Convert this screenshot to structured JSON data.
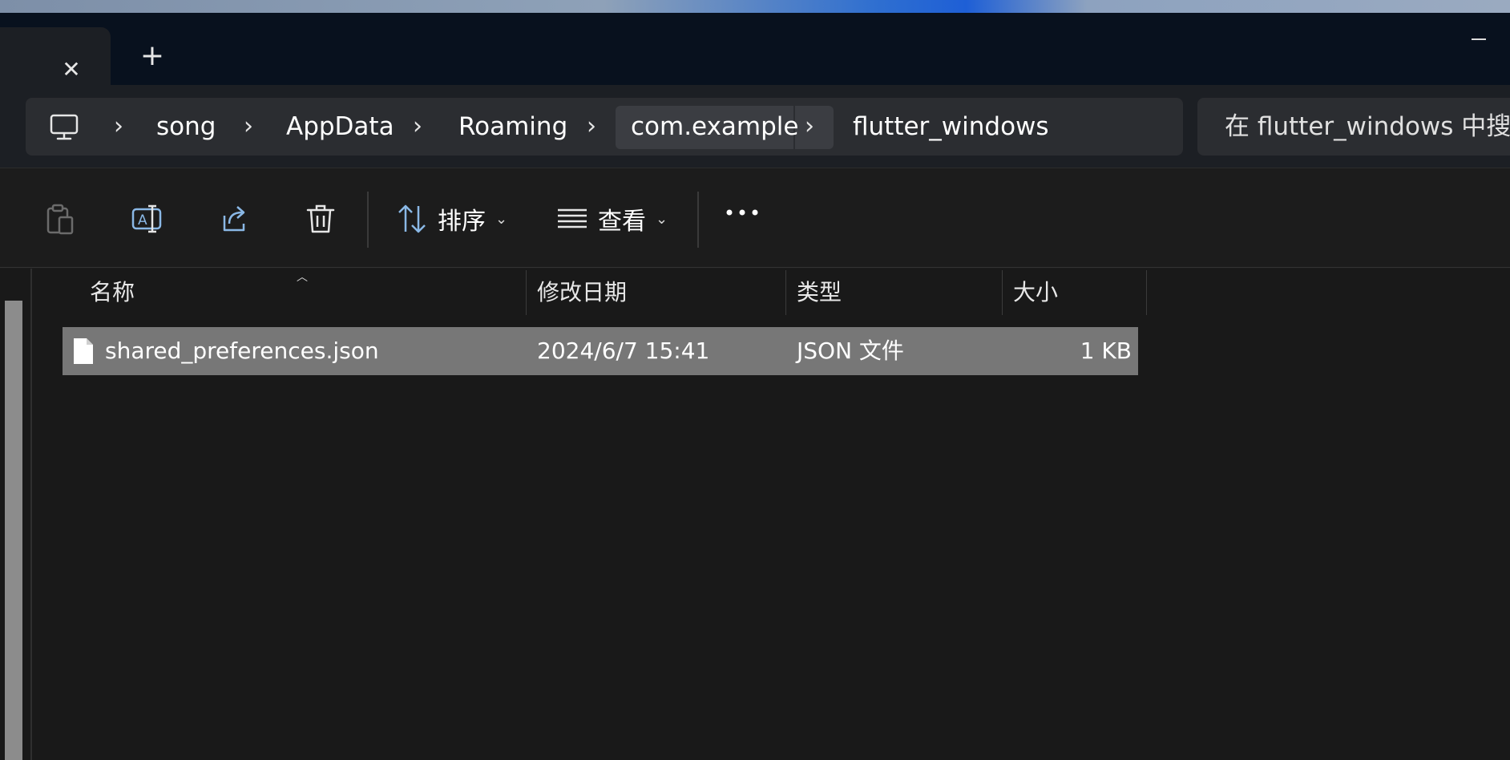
{
  "window": {
    "tab_close_glyph": "✕",
    "new_tab_glyph": "+"
  },
  "breadcrumb": {
    "root_icon": "this-pc-icon",
    "items": [
      "song",
      "AppData",
      "Roaming",
      "com.example",
      "flutter_windows"
    ],
    "separator": "›"
  },
  "search": {
    "placeholder": "在 flutter_windows 中搜索"
  },
  "toolbar": {
    "icons": [
      "paste-icon",
      "rename-icon",
      "share-icon",
      "delete-icon"
    ],
    "sort_label": "排序",
    "view_label": "查看",
    "caret": "⌄",
    "more_icon": "more-icon"
  },
  "columns": {
    "name": "名称",
    "modified": "修改日期",
    "type": "类型",
    "size": "大小"
  },
  "files": [
    {
      "name": "shared_preferences.json",
      "modified": "2024/6/7 15:41",
      "type": "JSON 文件",
      "size": "1 KB",
      "selected": true
    }
  ],
  "colors": {
    "titlebar": "#08111e",
    "surface": "#1c1f24",
    "selection": "#777777"
  }
}
